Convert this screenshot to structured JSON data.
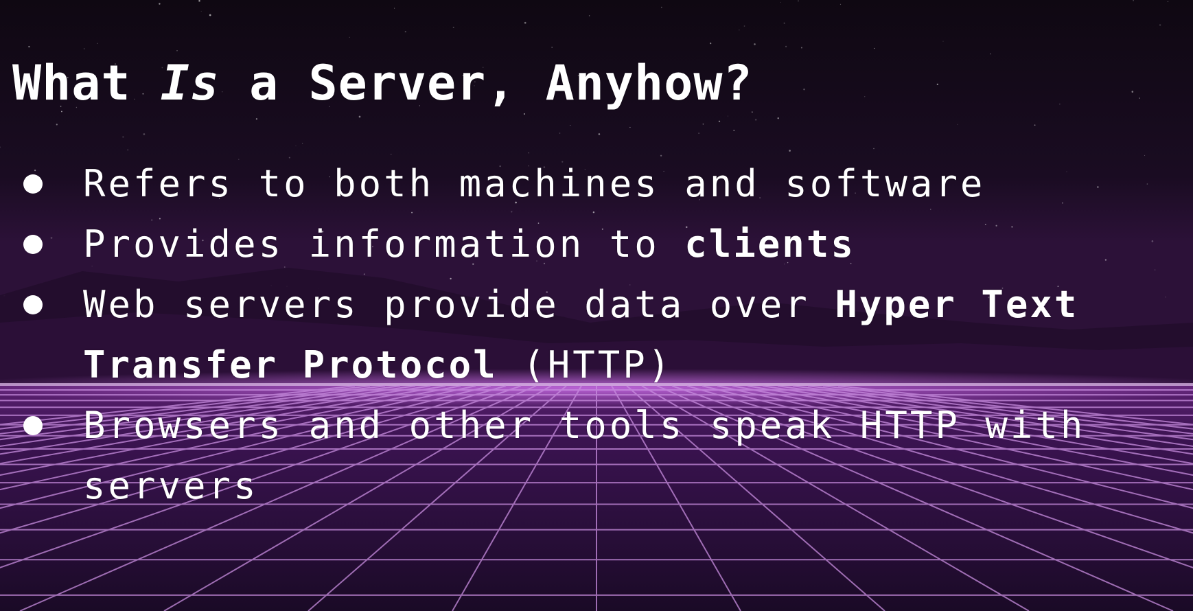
{
  "slide": {
    "title": {
      "before": "What ",
      "emphasis": "Is",
      "after": " a Server, Anyhow?"
    },
    "bullets": [
      {
        "text": "Refers to both machines and software"
      },
      {
        "text": "Provides information to ",
        "bold": "clients"
      },
      {
        "text": "Web servers provide data over ",
        "bold": "Hyper Text Transfer Protocol",
        "after": " (HTTP)"
      },
      {
        "text": "Browsers and other tools speak HTTP with servers"
      }
    ]
  },
  "colors": {
    "text": "#ffffff",
    "grid": "#c98ee0",
    "horizon_glow": "#b35ad0",
    "sky": "#140a18"
  }
}
